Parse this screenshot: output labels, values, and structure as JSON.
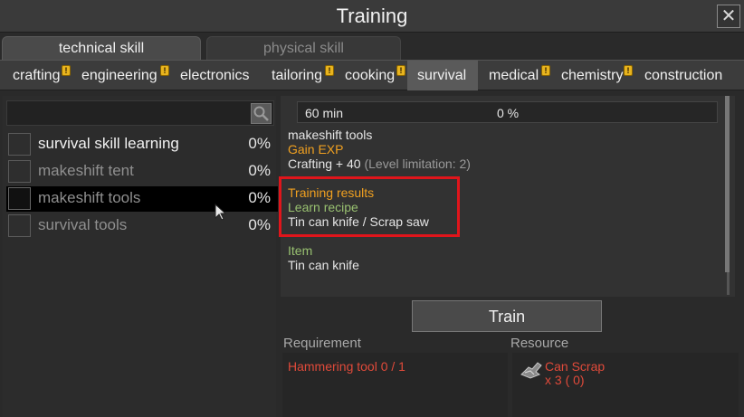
{
  "window": {
    "title": "Training",
    "close_label": "✕"
  },
  "top_tabs": [
    {
      "label": "technical skill",
      "active": true
    },
    {
      "label": "physical skill",
      "active": false
    }
  ],
  "categories": [
    {
      "label": "crafting",
      "warning": true
    },
    {
      "label": "engineering",
      "warning": true
    },
    {
      "label": "electronics",
      "warning": false
    },
    {
      "label": "tailoring",
      "warning": true
    },
    {
      "label": "cooking",
      "warning": true
    },
    {
      "label": "survival",
      "warning": false,
      "active": true
    },
    {
      "label": "medical",
      "warning": true
    },
    {
      "label": "chemistry",
      "warning": true
    },
    {
      "label": "construction",
      "warning": false
    }
  ],
  "warning_glyph": "!",
  "search": {
    "placeholder": ""
  },
  "skills": [
    {
      "name": "survival skill learning",
      "progress": "0%",
      "state": "bright"
    },
    {
      "name": "makeshift tent",
      "progress": "0%",
      "state": "dim"
    },
    {
      "name": "makeshift tools",
      "progress": "0%",
      "state": "selected"
    },
    {
      "name": "survival tools",
      "progress": "0%",
      "state": "dim"
    }
  ],
  "details": {
    "duration": "60 min",
    "progress": "0 %",
    "skill_name": "makeshift tools",
    "gain_exp_label": "Gain EXP",
    "exp_text": "Crafting + 40",
    "exp_limit": "(Level limitation: 2)",
    "results_label": "Training results",
    "learn_label": "Learn recipe",
    "recipes": "Tin can knife / Scrap saw",
    "item_label": "Item",
    "item_value": "Tin can knife"
  },
  "train_label": "Train",
  "requirement": {
    "header": "Requirement",
    "items": [
      "Hammering tool 0 / 1"
    ]
  },
  "resource": {
    "header": "Resource",
    "items": [
      {
        "name": "Can Scrap",
        "qty": "x 3 ( 0)",
        "icon": "can-scrap-icon"
      }
    ]
  },
  "colors": {
    "orange": "#f0a020",
    "green": "#98c070",
    "red": "#e04a3a",
    "highlight": "#e0151b"
  }
}
